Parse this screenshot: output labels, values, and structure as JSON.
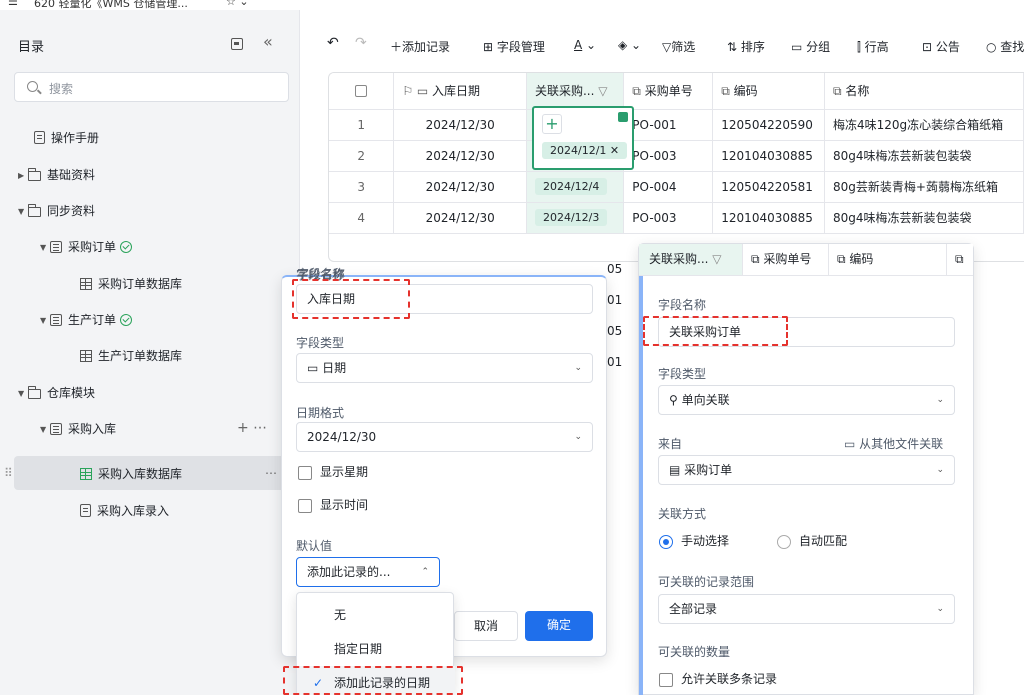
{
  "window": {
    "title": "620 轻量化《WMS 仓储管理..."
  },
  "sidebar": {
    "title": "目录",
    "search_placeholder": "搜索",
    "items": [
      {
        "label": "操作手册"
      },
      {
        "label": "基础资料"
      },
      {
        "label": "同步资料"
      },
      {
        "label": "采购订单"
      },
      {
        "label": "采购订单数据库"
      },
      {
        "label": "生产订单"
      },
      {
        "label": "生产订单数据库"
      },
      {
        "label": "仓库模块"
      },
      {
        "label": "采购入库"
      },
      {
        "label": "采购入库数据库"
      },
      {
        "label": "采购入库录入"
      }
    ]
  },
  "toolbar": {
    "add_record": "添加记录",
    "field_manage": "字段管理",
    "filter": "筛选",
    "sort": "排序",
    "group": "分组",
    "row_height": "行高",
    "notice": "公告",
    "find": "查找"
  },
  "grid": {
    "headers": [
      "入库日期",
      "关联采购...",
      "采购单号",
      "编码",
      "名称"
    ],
    "rows": [
      {
        "n": "1",
        "date": "2024/12/30",
        "link": "2024/12/1",
        "po": "PO-001",
        "code": "120504220590",
        "name": "梅冻4味120g冻心装综合箱纸箱"
      },
      {
        "n": "2",
        "date": "2024/12/30",
        "link": "",
        "po": "PO-003",
        "code": "120104030885",
        "name": "80g4味梅冻芸新装包装袋"
      },
      {
        "n": "3",
        "date": "2024/12/30",
        "link": "2024/12/4",
        "po": "PO-004",
        "code": "120504220581",
        "name": "80g芸新装青梅+蒟蒻梅冻纸箱"
      },
      {
        "n": "4",
        "date": "2024/12/30",
        "link": "2024/12/3",
        "po": "PO-003",
        "code": "120104030885",
        "name": "80g4味梅冻芸新装包装袋"
      }
    ],
    "partial_col": [
      "05",
      "01",
      "05",
      "01"
    ]
  },
  "left_panel": {
    "field_name_label": "字段名称",
    "field_name_value": "入库日期",
    "field_type_label": "字段类型",
    "field_type_value": "日期",
    "date_format_label": "日期格式",
    "date_format_value": "2024/12/30",
    "show_weekday": "显示星期",
    "show_time": "显示时间",
    "default_label": "默认值",
    "default_value": "添加此记录的...",
    "cancel": "取消",
    "confirm": "确定",
    "options": [
      "无",
      "指定日期",
      "添加此记录的日期"
    ]
  },
  "right_panel": {
    "headers": [
      "关联采购...",
      "采购单号",
      "编码"
    ],
    "field_name_label": "字段名称",
    "field_name_value": "关联采购订单",
    "field_type_label": "字段类型",
    "field_type_value": "单向关联",
    "source_label": "来自",
    "other_file_link": "从其他文件关联",
    "source_value": "采购订单",
    "mode_label": "关联方式",
    "mode_manual": "手动选择",
    "mode_auto": "自动匹配",
    "range_label": "可关联的记录范围",
    "range_value": "全部记录",
    "count_label": "可关联的数量",
    "allow_multiple": "允许关联多条记录"
  },
  "colors": {
    "accent": "#2a9d6e",
    "primary": "#1f6feb",
    "highlight_dash": "#e5322d"
  }
}
